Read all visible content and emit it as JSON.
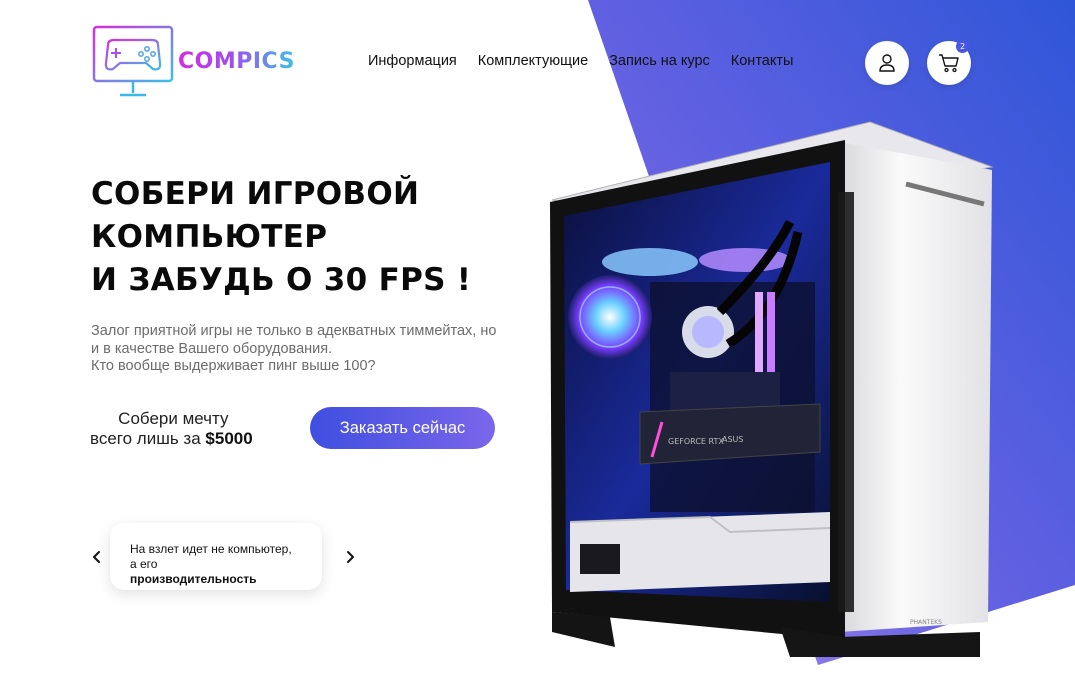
{
  "brand": {
    "name": "COMPICS"
  },
  "nav": {
    "items": [
      {
        "label": "Информация"
      },
      {
        "label": "Комплектующие"
      },
      {
        "label": "Запись на курс"
      },
      {
        "label": "Контакты"
      }
    ]
  },
  "header": {
    "cart_count": "2"
  },
  "hero": {
    "title_line1": "СОБЕРИ ИГРОВОЙ",
    "title_line2": "КОМПЬЮТЕР",
    "title_line3": "И  ЗАБУДЬ О  30 FPS !",
    "desc_line1": "Залог приятной игры не только в адекватных тиммейтах, но",
    "desc_line2": "и в качестве Вашего оборудования.",
    "desc_line3": "Кто вообще выдерживает пинг выше 100?",
    "price_line1": "Собери мечту",
    "price_prefix": "всего лишь за ",
    "price_value": "$5000",
    "order_label": "Заказать сейчас"
  },
  "slider": {
    "line1": "На взлет идет не компьютер,",
    "line2_prefix": "а его ",
    "line2_bold": "производительность"
  },
  "product_labels": {
    "gpu_text": "GEFORCE RTX",
    "gpu_brand": "ASUS",
    "case_brand": "PHANTEKS"
  },
  "colors": {
    "accent_start": "#3f4fe0",
    "accent_end": "#7a66ea",
    "bg_gradient_start": "#6d4fe3",
    "bg_gradient_end": "#3658dd",
    "logo_pink": "#d32ee0",
    "logo_cyan": "#3cc0e8"
  },
  "icons": {
    "logo": "gamepad-monitor-icon",
    "user": "user-icon",
    "cart": "cart-icon",
    "prev": "chevron-left-icon",
    "next": "chevron-right-icon"
  }
}
